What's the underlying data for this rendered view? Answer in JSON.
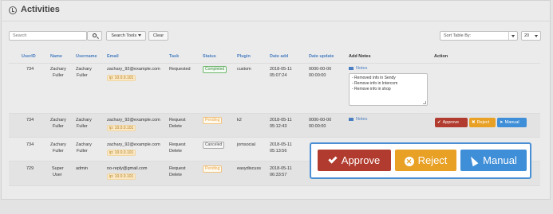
{
  "header": {
    "title": "Activities"
  },
  "toolbar": {
    "search_placeholder": "Search",
    "search_tools_label": "Search Tools",
    "clear_label": "Clear",
    "sort_label": "Sort Table By:",
    "limit_value": "20"
  },
  "columns": [
    "UserID",
    "Name",
    "Username",
    "Email",
    "Task",
    "Status",
    "Plugin",
    "Date add",
    "Date update",
    "Add Notes",
    "Action"
  ],
  "rows": [
    {
      "userid": "734",
      "name_first": "Zachary",
      "name_last": "Fuller",
      "user_first": "Zachary",
      "user_last": "Fuller",
      "email": "zachary_92@example.com",
      "ip": "ip: 10.0.0.101",
      "task": "Requested",
      "task2": "",
      "status": "Completed",
      "plugin": "custom",
      "date_add": "2018-05-11",
      "time_add": "05:07:24",
      "date_update": "0000-00-00",
      "time_update": "00:00:00",
      "notes_label": "Notes"
    },
    {
      "userid": "734",
      "name_first": "Zachary",
      "name_last": "Fuller",
      "user_first": "Zachary",
      "user_last": "Fuller",
      "email": "zachary_92@example.com",
      "ip": "ip: 10.0.0.101",
      "task": "Request",
      "task2": "Delete",
      "status": "Pending",
      "plugin": "k2",
      "date_add": "2018-05-11",
      "time_add": "05:12:43",
      "date_update": "0000-00-00",
      "time_update": "00:00:00",
      "notes_label": "Notes"
    },
    {
      "userid": "734",
      "name_first": "Zachary",
      "name_last": "Fuller",
      "user_first": "Zachary",
      "user_last": "Fuller",
      "email": "zachary_92@example.com",
      "ip": "ip: 10.0.0.101",
      "task": "Request",
      "task2": "Delete",
      "status": "Canceled",
      "plugin": "jomsocial",
      "date_add": "2018-05-11",
      "time_add": "05:13:56",
      "date_update": "",
      "time_update": "",
      "notes_label": ""
    },
    {
      "userid": "729",
      "name_first": "Super",
      "name_last": "User",
      "user_first": "admin",
      "user_last": "",
      "email": "no-reply@gmail.com",
      "ip": "ip: 10.0.0.101",
      "task": "Request",
      "task2": "Delete",
      "status": "Pending",
      "plugin": "easydiscuss",
      "date_add": "2018-05-11",
      "time_add": "06:33:57",
      "date_update": "",
      "time_update": "",
      "notes_label": ""
    }
  ],
  "notes_text": [
    "- Removed info in Sendy",
    "- Remove info in Intercom",
    "- Remove info in shop"
  ],
  "actions": {
    "approve": "Approve",
    "reject": "Reject",
    "manual": "Manual"
  },
  "colors": {
    "approve": "#b13b2e",
    "reject": "#e8a025",
    "manual": "#3f8ed8",
    "link": "#4a7fc1"
  }
}
